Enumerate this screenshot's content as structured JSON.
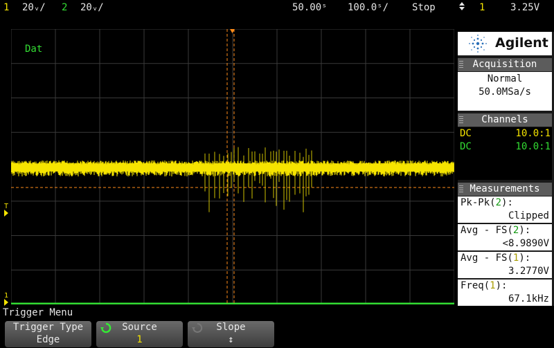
{
  "topbar": {
    "ch1_num": "1",
    "ch1_scale": "20ᵥ/",
    "ch2_num": "2",
    "ch2_scale": "20ᵥ/",
    "time_delay": "50.00ˢ",
    "time_scale": "100.0ˢ/",
    "run_state": "Stop",
    "trigger_symbol": "⬍",
    "trigger_source": "1",
    "trigger_level": "3.25V"
  },
  "display": {
    "label": "Dat",
    "trigger_marker": "T",
    "ground_marker": "1"
  },
  "sidebar": {
    "brand": "Agilent",
    "acquisition": {
      "header": "Acquisition",
      "mode": "Normal",
      "rate": "50.0MSa/s"
    },
    "channels": {
      "header": "Channels",
      "rows": [
        {
          "coupling": "DC",
          "probe": "10.0:1"
        },
        {
          "coupling": "DC",
          "probe": "10.0:1"
        }
      ]
    },
    "measurements": {
      "header": "Measurements",
      "items": [
        {
          "name": "Pk-Pk",
          "src": "2",
          "value": "Clipped"
        },
        {
          "name": "Avg - FS",
          "src": "2",
          "value": "<8.9890V"
        },
        {
          "name": "Avg - FS",
          "src": "1",
          "value": "3.2770V"
        },
        {
          "name": "Freq",
          "src": "1",
          "value": "67.1kHz"
        }
      ]
    }
  },
  "menu": {
    "title": "Trigger Menu",
    "softkeys": [
      {
        "label": "Trigger Type",
        "value": "Edge"
      },
      {
        "label": "Source",
        "value": "1"
      },
      {
        "label": "Slope",
        "value": "↕"
      }
    ]
  },
  "colors": {
    "ch1": "#f5e400",
    "ch2": "#33dd33",
    "cursor": "#ff8c1a"
  }
}
